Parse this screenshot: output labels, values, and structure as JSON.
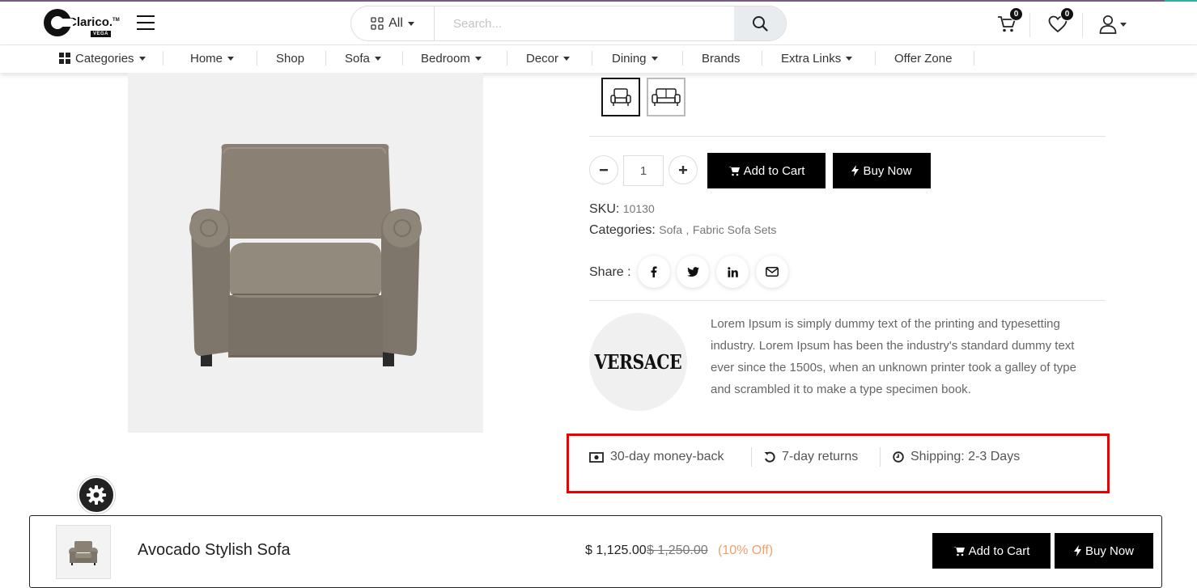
{
  "header": {
    "logo_text": "Clarico.",
    "logo_tm": "TM",
    "logo_sub": "VEGA",
    "search_category": "All",
    "search_placeholder": "Search...",
    "cart_count": "0",
    "wishlist_count": "0"
  },
  "nav": {
    "items": [
      {
        "label": "Categories",
        "caret": true,
        "icon": "grid-icon"
      },
      {
        "label": "Home",
        "caret": true
      },
      {
        "label": "Shop",
        "caret": false
      },
      {
        "label": "Sofa",
        "caret": true
      },
      {
        "label": "Bedroom",
        "caret": true
      },
      {
        "label": "Decor",
        "caret": true
      },
      {
        "label": "Dining",
        "caret": true
      },
      {
        "label": "Brands",
        "caret": false
      },
      {
        "label": "Extra Links",
        "caret": true
      },
      {
        "label": "Offer Zone",
        "caret": false
      }
    ]
  },
  "product": {
    "variants": [
      {
        "icon": "armchair-icon",
        "selected": true
      },
      {
        "icon": "sofa-icon",
        "selected": false
      }
    ],
    "quantity": "1",
    "add_to_cart_label": "Add to Cart",
    "buy_now_label": "Buy Now",
    "sku_label": "SKU:",
    "sku_value": "10130",
    "categories_label": "Categories:",
    "category_1": "Sofa",
    "category_sep": ",",
    "category_2": "Fabric Sofa Sets",
    "share_label": "Share :",
    "share_icons": [
      "facebook-icon",
      "twitter-icon",
      "linkedin-icon",
      "envelope-icon"
    ],
    "brand_logo_text": "VERSACE",
    "brand_description": "Lorem Ipsum is simply dummy text of the printing and typesetting industry. Lorem Ipsum has been the industry's standard dummy text ever since the 1500s, when an unknown printer took a galley of type and scrambled it to make a type specimen book."
  },
  "features": [
    {
      "icon": "money-icon",
      "label": "30-day money-back"
    },
    {
      "icon": "undo-icon",
      "label": "7-day returns"
    },
    {
      "icon": "clock-icon",
      "label": "Shipping: 2-3 Days"
    }
  ],
  "sticky_bar": {
    "product_name": "Avocado Stylish Sofa",
    "price": "$ 1,125.00",
    "old_price": "$ 1,250.00",
    "discount": "(10% Off)",
    "add_to_cart_label": "Add to Cart",
    "buy_now_label": "Buy Now"
  },
  "colors": {
    "accent_black": "#000000",
    "highlight_border": "#ee0000",
    "discount_text": "#f0a070"
  }
}
